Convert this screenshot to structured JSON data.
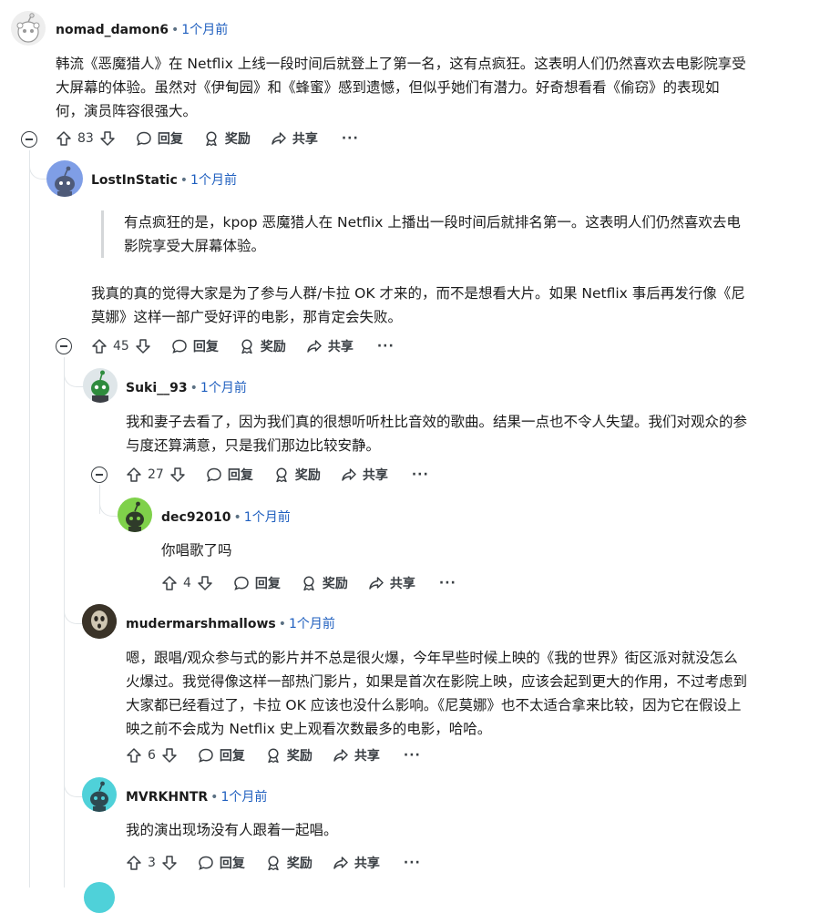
{
  "comments": [
    {
      "user": "nomad_damon6",
      "time": "1个月前",
      "lines": [
        "韩流《恶魔猎人》在 Netflix 上线一段时间后就登上了第一名，这有点疯狂。这表明人们仍然喜欢去电影院享受",
        "大屏幕的体验。虽然对《伊甸园》和《蜂蜜》感到遗憾，但似乎她们有潜力。好奇想看看《偷窃》的表现如",
        "何，演员阵容很强大。"
      ],
      "votes": "83"
    },
    {
      "user": "LostInStatic",
      "time": "1个月前",
      "quote_lines": [
        "有点疯狂的是，kpop 恶魔猎人在 Netflix 上播出一段时间后就排名第一。这表明人们仍然喜欢去电",
        "影院享受大屏幕体验。"
      ],
      "lines": [
        "我真的真的觉得大家是为了参与人群/卡拉 OK 才来的，而不是想看大片。如果 Netflix 事后再发行像《尼",
        "莫娜》这样一部广受好评的电影，那肯定会失败。"
      ],
      "votes": "45"
    },
    {
      "user": "Suki__93",
      "time": "1个月前",
      "lines": [
        "我和妻子去看了，因为我们真的很想听听杜比音效的歌曲。结果一点也不令人失望。我们对观众的参",
        "与度还算满意，只是我们那边比较安静。"
      ],
      "votes": "27"
    },
    {
      "user": "dec92010",
      "time": "1个月前",
      "lines": [
        "你唱歌了吗"
      ],
      "votes": "4"
    },
    {
      "user": "mudermarshmallows",
      "time": "1个月前",
      "lines": [
        "嗯，跟唱/观众参与式的影片并不总是很火爆，今年早些时候上映的《我的世界》街区派对就没怎么",
        "火爆过。我觉得像这样一部热门影片，如果是首次在影院上映，应该会起到更大的作用，不过考虑到",
        "大家都已经看过了，卡拉 OK 应该也没什么影响。《尼莫娜》也不太适合拿来比较，因为它在假设上",
        "映之前不会成为 Netflix 史上观看次数最多的电影，哈哈。"
      ],
      "votes": "6"
    },
    {
      "user": "MVRKHNTR",
      "time": "1个月前",
      "lines": [
        "我的演出现场没有人跟着一起唱。"
      ],
      "votes": "3"
    }
  ],
  "actions": {
    "reply": "回复",
    "award": "奖励",
    "share": "共享",
    "more": "···"
  },
  "separator": "•",
  "icons": {
    "upvote": "upvote-arrow-icon",
    "downvote": "downvote-arrow-icon",
    "reply": "speech-bubble-icon",
    "award": "award-ribbon-icon",
    "share": "share-arrow-icon",
    "collapse": "collapse-minus-icon"
  },
  "colors": {
    "link": "#1f5fbf",
    "thread_line": "#e2e6e9",
    "text": "#1c1c1c"
  }
}
